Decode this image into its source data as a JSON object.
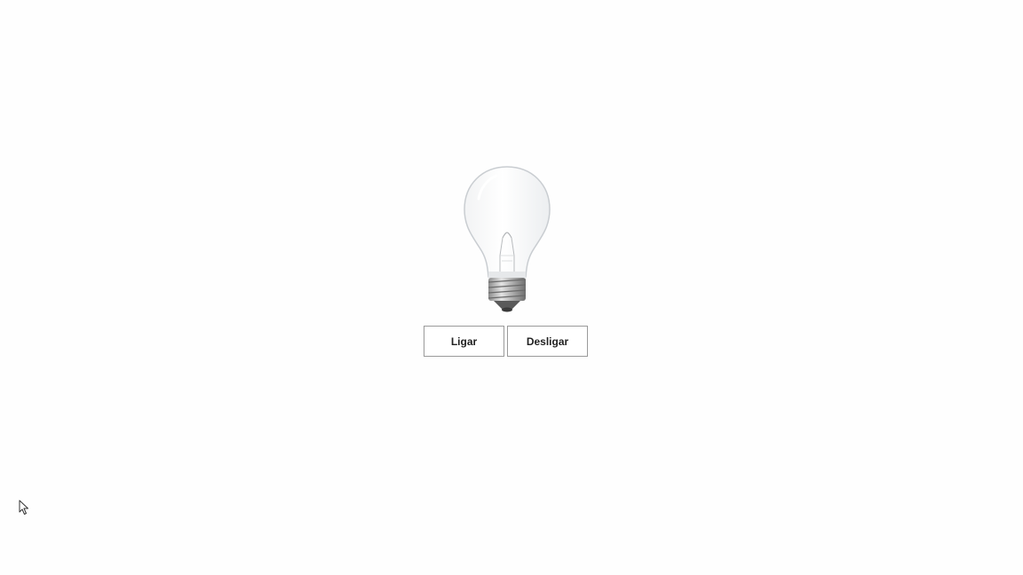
{
  "lamp": {
    "state": "off",
    "icon": "lightbulb-icon"
  },
  "controls": {
    "on_label": "Ligar",
    "off_label": "Desligar"
  },
  "pointer": {
    "icon": "mouse-cursor-icon"
  }
}
